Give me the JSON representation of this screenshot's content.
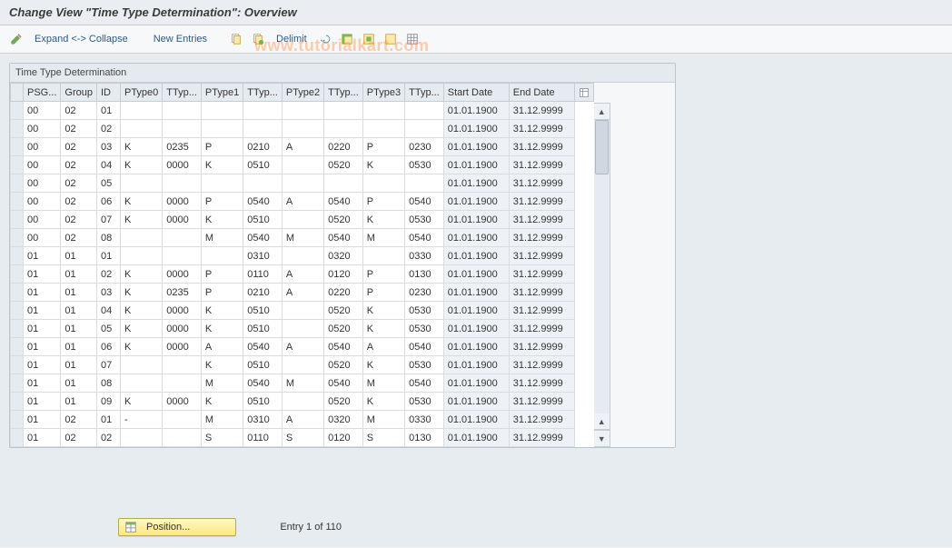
{
  "title": "Change View \"Time Type Determination\": Overview",
  "watermark": "www.tutorialkart.com",
  "toolbar": {
    "expand_collapse": "Expand <-> Collapse",
    "new_entries": "New Entries",
    "delimit": "Delimit"
  },
  "panel": {
    "title": "Time Type Determination"
  },
  "columns": [
    "PSG...",
    "Group",
    "ID",
    "PType0",
    "TTyp...",
    "PType1",
    "TTyp...",
    "PType2",
    "TTyp...",
    "PType3",
    "TTyp...",
    "Start Date",
    "End Date"
  ],
  "rows": [
    {
      "psg": "00",
      "grp": "02",
      "id": "01",
      "p0": "",
      "t0": "",
      "p1": "",
      "t1": "",
      "p2": "",
      "t2": "",
      "p3": "",
      "t3": "",
      "sd": "01.01.1900",
      "ed": "31.12.9999"
    },
    {
      "psg": "00",
      "grp": "02",
      "id": "02",
      "p0": "",
      "t0": "",
      "p1": "",
      "t1": "",
      "p2": "",
      "t2": "",
      "p3": "",
      "t3": "",
      "sd": "01.01.1900",
      "ed": "31.12.9999"
    },
    {
      "psg": "00",
      "grp": "02",
      "id": "03",
      "p0": "K",
      "t0": "0235",
      "p1": "P",
      "t1": "0210",
      "p2": "A",
      "t2": "0220",
      "p3": "P",
      "t3": "0230",
      "sd": "01.01.1900",
      "ed": "31.12.9999"
    },
    {
      "psg": "00",
      "grp": "02",
      "id": "04",
      "p0": "K",
      "t0": "0000",
      "p1": "K",
      "t1": "0510",
      "p2": "",
      "t2": "0520",
      "p3": "K",
      "t3": "0530",
      "sd": "01.01.1900",
      "ed": "31.12.9999"
    },
    {
      "psg": "00",
      "grp": "02",
      "id": "05",
      "p0": "",
      "t0": "",
      "p1": "",
      "t1": "",
      "p2": "",
      "t2": "",
      "p3": "",
      "t3": "",
      "sd": "01.01.1900",
      "ed": "31.12.9999"
    },
    {
      "psg": "00",
      "grp": "02",
      "id": "06",
      "p0": "K",
      "t0": "0000",
      "p1": "P",
      "t1": "0540",
      "p2": "A",
      "t2": "0540",
      "p3": "P",
      "t3": "0540",
      "sd": "01.01.1900",
      "ed": "31.12.9999"
    },
    {
      "psg": "00",
      "grp": "02",
      "id": "07",
      "p0": "K",
      "t0": "0000",
      "p1": "K",
      "t1": "0510",
      "p2": "",
      "t2": "0520",
      "p3": "K",
      "t3": "0530",
      "sd": "01.01.1900",
      "ed": "31.12.9999"
    },
    {
      "psg": "00",
      "grp": "02",
      "id": "08",
      "p0": "",
      "t0": "",
      "p1": "M",
      "t1": "0540",
      "p2": "M",
      "t2": "0540",
      "p3": "M",
      "t3": "0540",
      "sd": "01.01.1900",
      "ed": "31.12.9999"
    },
    {
      "psg": "01",
      "grp": "01",
      "id": "01",
      "p0": "",
      "t0": "",
      "p1": "",
      "t1": "0310",
      "p2": "",
      "t2": "0320",
      "p3": "",
      "t3": "0330",
      "sd": "01.01.1900",
      "ed": "31.12.9999"
    },
    {
      "psg": "01",
      "grp": "01",
      "id": "02",
      "p0": "K",
      "t0": "0000",
      "p1": "P",
      "t1": "0110",
      "p2": "A",
      "t2": "0120",
      "p3": "P",
      "t3": "0130",
      "sd": "01.01.1900",
      "ed": "31.12.9999"
    },
    {
      "psg": "01",
      "grp": "01",
      "id": "03",
      "p0": "K",
      "t0": "0235",
      "p1": "P",
      "t1": "0210",
      "p2": "A",
      "t2": "0220",
      "p3": "P",
      "t3": "0230",
      "sd": "01.01.1900",
      "ed": "31.12.9999"
    },
    {
      "psg": "01",
      "grp": "01",
      "id": "04",
      "p0": "K",
      "t0": "0000",
      "p1": "K",
      "t1": "0510",
      "p2": "",
      "t2": "0520",
      "p3": "K",
      "t3": "0530",
      "sd": "01.01.1900",
      "ed": "31.12.9999"
    },
    {
      "psg": "01",
      "grp": "01",
      "id": "05",
      "p0": "K",
      "t0": "0000",
      "p1": "K",
      "t1": "0510",
      "p2": "",
      "t2": "0520",
      "p3": "K",
      "t3": "0530",
      "sd": "01.01.1900",
      "ed": "31.12.9999"
    },
    {
      "psg": "01",
      "grp": "01",
      "id": "06",
      "p0": "K",
      "t0": "0000",
      "p1": "A",
      "t1": "0540",
      "p2": "A",
      "t2": "0540",
      "p3": "A",
      "t3": "0540",
      "sd": "01.01.1900",
      "ed": "31.12.9999"
    },
    {
      "psg": "01",
      "grp": "01",
      "id": "07",
      "p0": "",
      "t0": "",
      "p1": "K",
      "t1": "0510",
      "p2": "",
      "t2": "0520",
      "p3": "K",
      "t3": "0530",
      "sd": "01.01.1900",
      "ed": "31.12.9999"
    },
    {
      "psg": "01",
      "grp": "01",
      "id": "08",
      "p0": "",
      "t0": "",
      "p1": "M",
      "t1": "0540",
      "p2": "M",
      "t2": "0540",
      "p3": "M",
      "t3": "0540",
      "sd": "01.01.1900",
      "ed": "31.12.9999"
    },
    {
      "psg": "01",
      "grp": "01",
      "id": "09",
      "p0": "K",
      "t0": "0000",
      "p1": "K",
      "t1": "0510",
      "p2": "",
      "t2": "0520",
      "p3": "K",
      "t3": "0530",
      "sd": "01.01.1900",
      "ed": "31.12.9999"
    },
    {
      "psg": "01",
      "grp": "02",
      "id": "01",
      "p0": "-",
      "t0": "",
      "p1": "M",
      "t1": "0310",
      "p2": "A",
      "t2": "0320",
      "p3": "M",
      "t3": "0330",
      "sd": "01.01.1900",
      "ed": "31.12.9999"
    },
    {
      "psg": "01",
      "grp": "02",
      "id": "02",
      "p0": "",
      "t0": "",
      "p1": "S",
      "t1": "0110",
      "p2": "S",
      "t2": "0120",
      "p3": "S",
      "t3": "0130",
      "sd": "01.01.1900",
      "ed": "31.12.9999"
    }
  ],
  "footer": {
    "position_label": "Position...",
    "entry_text": "Entry 1 of 110"
  },
  "icons": {
    "pencil": "pencil-icon",
    "copy": "copy-icon",
    "sheet_green": "sheet-green-icon",
    "arrow_undo": "undo-icon",
    "table_sel": "select-all-icon",
    "table_block": "select-block-icon",
    "table_desel": "deselect-icon",
    "table_conf": "table-settings-icon",
    "position": "position-icon"
  }
}
